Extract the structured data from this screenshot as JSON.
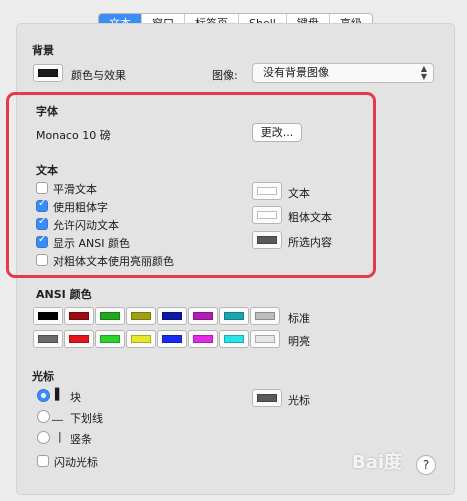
{
  "tabs": [
    {
      "label": "文本",
      "active": true
    },
    {
      "label": "窗口",
      "active": false
    },
    {
      "label": "标签页",
      "active": false
    },
    {
      "label": "Shell",
      "active": false
    },
    {
      "label": "键盘",
      "active": false
    },
    {
      "label": "高级",
      "active": false
    }
  ],
  "background": {
    "title": "背景",
    "color_effect_label": "颜色与效果",
    "image_label": "图像:",
    "image_value": "没有背景图像"
  },
  "font": {
    "title": "字体",
    "current": "Monaco 10 磅",
    "change_button": "更改..."
  },
  "text": {
    "title": "文本",
    "options": [
      {
        "label": "平滑文本",
        "checked": false
      },
      {
        "label": "使用粗体字",
        "checked": true
      },
      {
        "label": "允许闪动文本",
        "checked": true
      },
      {
        "label": "显示 ANSI 颜色",
        "checked": true
      },
      {
        "label": "对粗体文本使用亮丽颜色",
        "checked": false
      }
    ],
    "colors": [
      {
        "label": "文本",
        "color": "#ffffff"
      },
      {
        "label": "粗体文本",
        "color": "#ffffff"
      },
      {
        "label": "所选内容",
        "color": "#5a5a5a"
      }
    ]
  },
  "ansi": {
    "title": "ANSI 颜色",
    "normal_label": "标准",
    "bright_label": "明亮",
    "normal": [
      "#000000",
      "#9b0d12",
      "#20a620",
      "#a0a010",
      "#0d1aa8",
      "#b01cb6",
      "#1aa6b0",
      "#bdbdbd"
    ],
    "bright": [
      "#6a6a6a",
      "#e3141b",
      "#2ad42a",
      "#e6e62a",
      "#1a2af0",
      "#e02ae6",
      "#2ae3e8",
      "#e6e6e6"
    ]
  },
  "cursor": {
    "title": "光标",
    "options": [
      {
        "glyph": "▌",
        "label": "块",
        "selected": true
      },
      {
        "glyph": "__",
        "label": "下划线",
        "selected": false
      },
      {
        "glyph": "|",
        "label": "竖条",
        "selected": false
      }
    ],
    "blink_label": "闪动光标",
    "color_label": "光标",
    "color": "#5a5a5a"
  },
  "help_label": "?",
  "watermark": "Bai度"
}
